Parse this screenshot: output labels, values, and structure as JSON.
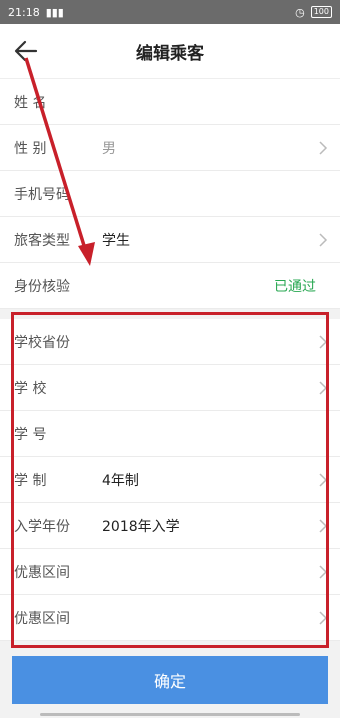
{
  "status": {
    "time": "21:18",
    "signal": "5G",
    "battery": "100"
  },
  "header": {
    "title": "编辑乘客",
    "back_icon": "back-arrow-icon"
  },
  "rows": [
    {
      "label": "姓  名",
      "value": ""
    },
    {
      "label": "性  别",
      "value": "男"
    },
    {
      "label": "手机号码",
      "value": ""
    },
    {
      "label": "旅客类型",
      "value": "学生"
    },
    {
      "label": "身份核验",
      "value": "已通过"
    }
  ],
  "student_rows": [
    {
      "label": "学校省份",
      "value": ""
    },
    {
      "label": "学  校",
      "value": ""
    },
    {
      "label": "学  号",
      "value": ""
    },
    {
      "label": "学  制",
      "value": "4年制"
    },
    {
      "label": "入学年份",
      "value": "2018年入学"
    },
    {
      "label": "优惠区间",
      "value": ""
    },
    {
      "label": "优惠区间",
      "value": ""
    }
  ],
  "footer": {
    "confirm_label": "确定"
  },
  "colors": {
    "verified": "#2aa853",
    "annotation": "#c8202a",
    "primary": "#4a90e2"
  }
}
